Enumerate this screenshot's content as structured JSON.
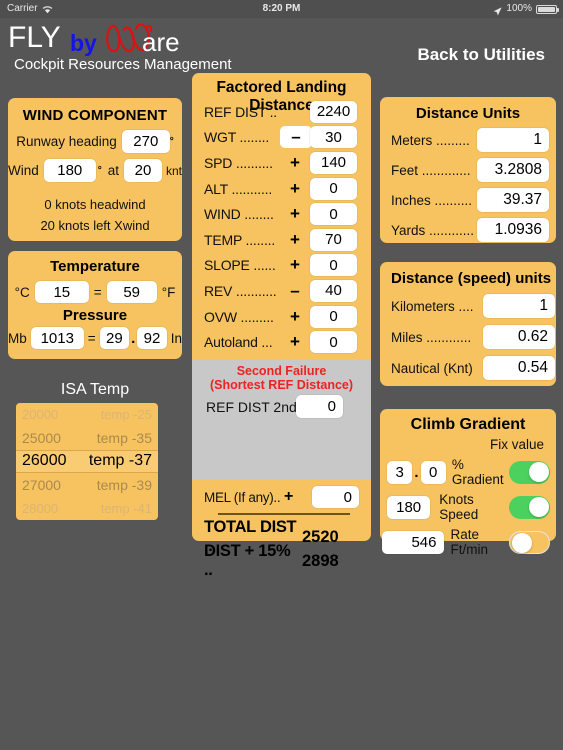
{
  "statusbar": {
    "carrier": "Carrier",
    "wifi_icon": "wifi-icon",
    "time": "8:20 PM",
    "location_icon": "location-arrow-icon",
    "battery_pct": "100%",
    "battery_icon": "battery-full-icon"
  },
  "header": {
    "logo_fly": "FLY",
    "logo_by": "by",
    "logo_w": "w-script-icon",
    "logo_are": "are",
    "subtitle": "Cockpit Resources Management",
    "back_label": "Back to Utilities"
  },
  "wind_component": {
    "title": "WIND COMPONENT",
    "runway_heading_label": "Runway heading",
    "runway_heading_value": "270",
    "deg_symbol": "°",
    "wind_label": "Wind",
    "wind_dir_value": "180",
    "at_label": "at",
    "wind_speed_value": "20",
    "knt_label": "knt",
    "note1": "0 knots headwind",
    "note2": "20 knots left Xwind"
  },
  "temperature": {
    "title": "Temperature",
    "celsius_unit": "°C",
    "celsius_value": "15",
    "equals": "=",
    "fahrenheit_value": "59",
    "fahrenheit_unit": "°F",
    "pressure_title": "Pressure",
    "mb_label": "Mb",
    "mb_value": "1013",
    "inhg_int": "29",
    "inhg_dot": ".",
    "inhg_dec": "92",
    "in_label": "In"
  },
  "isa_temp": {
    "title": "ISA Temp",
    "items": [
      {
        "alt": "20000",
        "temp": "temp -25"
      },
      {
        "alt": "25000",
        "temp": "temp -35"
      },
      {
        "alt": "26000",
        "temp": "temp -37"
      },
      {
        "alt": "27000",
        "temp": "temp -39"
      },
      {
        "alt": "28000",
        "temp": "temp -41"
      }
    ],
    "selected_index": 2
  },
  "factored_landing_distance": {
    "title": "Factored Landing Distance",
    "rows": [
      {
        "label": "REF DIST ..",
        "sign": "",
        "value": "2240"
      },
      {
        "label": "WGT ........",
        "sign": "–",
        "sign_boxed": true,
        "value": "30"
      },
      {
        "label": "SPD ..........",
        "sign": "+",
        "value": "140"
      },
      {
        "label": "ALT ...........",
        "sign": "+",
        "value": "0"
      },
      {
        "label": "WIND ........",
        "sign": "+",
        "value": "0"
      },
      {
        "label": "TEMP ........",
        "sign": "+",
        "value": "70"
      },
      {
        "label": "SLOPE ......",
        "sign": "+",
        "value": "0"
      },
      {
        "label": "REV ...........",
        "sign": "–",
        "value": "40"
      },
      {
        "label": "OVW .........",
        "sign": "+",
        "value": "0"
      },
      {
        "label": "Autoland ...",
        "sign": "+",
        "value": "0"
      }
    ],
    "second_failure": {
      "line1": "Second Failure",
      "line2": "(Shortest REF Distance)",
      "ref_dist_2nd_label": "REF DIST 2nd",
      "ref_dist_2nd_value": "0",
      "bg_color": "#c8c8c8",
      "text_color": "#ee2222"
    },
    "mel_label": "MEL (If any)..",
    "mel_sign": "+",
    "mel_value": "0",
    "total_dist_label": "TOTAL DIST ..",
    "total_dist_value": "2520",
    "dist_15_label": "DIST + 15% ..",
    "dist_15_value": "2898"
  },
  "distance_units": {
    "title": "Distance Units",
    "rows": [
      {
        "label": "Meters .........",
        "value": "1"
      },
      {
        "label": "Feet .............",
        "value": "3.2808"
      },
      {
        "label": "Inches ..........",
        "value": "39.37"
      },
      {
        "label": "Yards ............",
        "value": "1.0936"
      }
    ]
  },
  "speed_units": {
    "title": "Distance (speed) units",
    "rows": [
      {
        "label": "Kilometers ....",
        "value": "1"
      },
      {
        "label": "Miles ............",
        "value": "0.62"
      },
      {
        "label": "Nautical (Knt)",
        "value": "0.54"
      }
    ]
  },
  "climb_gradient": {
    "title": "Climb Gradient",
    "fix_value_label": "Fix value",
    "gradient_int": "3",
    "gradient_dot": ".",
    "gradient_dec": "0",
    "gradient_label": "% Gradient",
    "gradient_toggle": "on",
    "knots_value": "180",
    "knots_label": "Knots Speed",
    "knots_toggle": "on",
    "rate_value": "546",
    "rate_label": "Rate Ft/min",
    "rate_toggle": "off"
  },
  "colors": {
    "panel_bg": "#F7C360",
    "page_bg": "#565656",
    "toggle_on": "#4CD15F",
    "alert_red": "#ee2222",
    "logo_blue": "#1414e6",
    "logo_red": "#dd1111"
  }
}
